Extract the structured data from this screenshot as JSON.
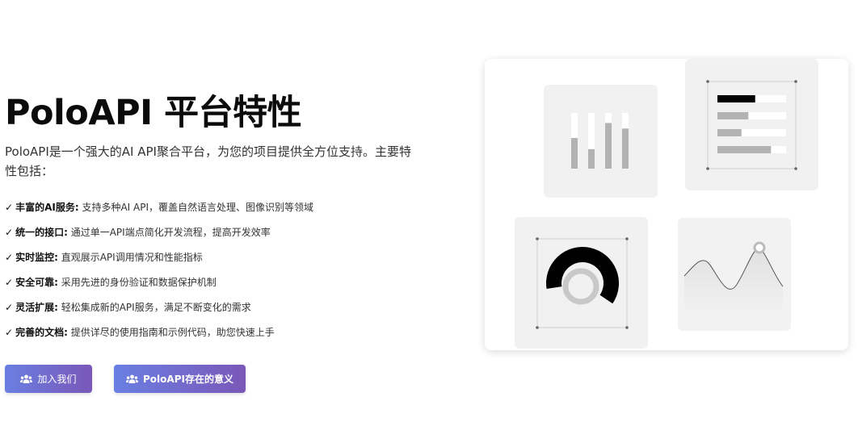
{
  "hero": {
    "title": "PoloAPI 平台特性",
    "description": "PoloAPI是一个强大的AI API聚合平台，为您的项目提供全方位支持。主要特性包括："
  },
  "features": [
    {
      "check": "✓",
      "title": "丰富的AI服务:",
      "text": "支持多种AI API，覆盖自然语言处理、图像识别等领域"
    },
    {
      "check": "✓",
      "title": "统一的接口:",
      "text": "通过单一API端点简化开发流程，提高开发效率"
    },
    {
      "check": "✓",
      "title": "实时监控:",
      "text": "直观展示API调用情况和性能指标"
    },
    {
      "check": "✓",
      "title": "安全可靠:",
      "text": "采用先进的身份验证和数据保护机制"
    },
    {
      "check": "✓",
      "title": "灵活扩展:",
      "text": "轻松集成新的API服务，满足不断变化的需求"
    },
    {
      "check": "✓",
      "title": "完善的文档:",
      "text": "提供详尽的使用指南和示例代码，助您快速上手"
    }
  ],
  "buttons": {
    "join": {
      "label": "加入我们",
      "icon": "users-icon"
    },
    "meaning": {
      "label": "PoloAPI存在的意义",
      "icon": "users-icon"
    }
  },
  "colors": {
    "button_gradient_start": "#6a7fe2",
    "button_gradient_end": "#7a58b8",
    "card_background": "#f1f1f1"
  },
  "illustration": {
    "bar_levels": [
      0.55,
      0.35,
      0.82,
      0.72
    ],
    "hbar_levels": [
      0.55,
      0.45,
      0.35,
      0.78
    ],
    "donut_level": 0.62
  }
}
